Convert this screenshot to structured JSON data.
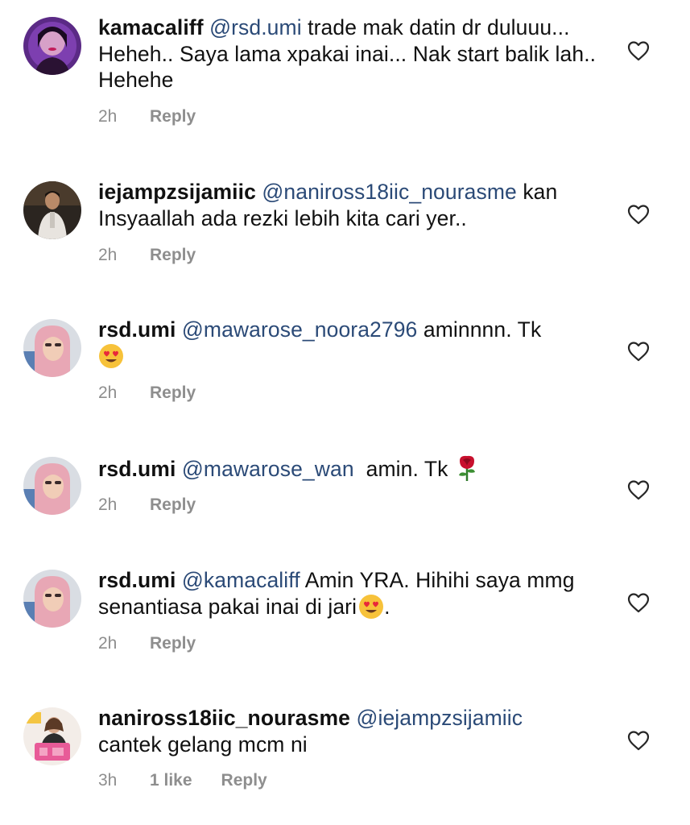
{
  "comments": [
    {
      "username": "kamacaliff",
      "mention": "@rsd.umi",
      "text": " trade mak datin dr duluuu... Heheh.. Saya lama xpakai inai... Nak start balik lah.. Hehehe",
      "time": "2h",
      "likes": "",
      "reply_label": "Reply",
      "avatar": "avatar-purple-woman"
    },
    {
      "username": "iejampzsijamiic",
      "mention": "@naniross18iic_nourasme",
      "text": " kan Insyaallah ada rezki lebih kita cari yer..",
      "time": "2h",
      "likes": "",
      "reply_label": "Reply",
      "avatar": "avatar-man-dark"
    },
    {
      "username": "rsd.umi",
      "mention": "@mawarose_noora2796",
      "text": " aminnnn. Tk",
      "emoji": "heart-eyes-emoji",
      "time": "2h",
      "likes": "",
      "reply_label": "Reply",
      "avatar": "avatar-pink-hijab"
    },
    {
      "username": "rsd.umi",
      "mention": "@mawarose_wan",
      "text": "  amin. Tk ",
      "emoji": "rose-emoji",
      "time": "2h",
      "likes": "",
      "reply_label": "Reply",
      "avatar": "avatar-pink-hijab"
    },
    {
      "username": "rsd.umi",
      "mention": "@kamacaliff",
      "text": " Amin YRA. Hihihi saya mmg senantiasa pakai inai di jari",
      "text_after": ".",
      "emoji": "heart-eyes-emoji",
      "time": "2h",
      "likes": "",
      "reply_label": "Reply",
      "avatar": "avatar-pink-hijab"
    },
    {
      "username": "naniross18iic_nourasme",
      "mention": "@iejampzsijamiic",
      "text": " cantek gelang mcm ni",
      "time": "3h",
      "likes": "1 like",
      "reply_label": "Reply",
      "avatar": "avatar-woman-pink-box"
    }
  ],
  "icons": {
    "like": "heart-outline-icon"
  },
  "colors": {
    "text": "#111111",
    "mention": "#2b4a77",
    "meta": "#8e8e8e"
  }
}
